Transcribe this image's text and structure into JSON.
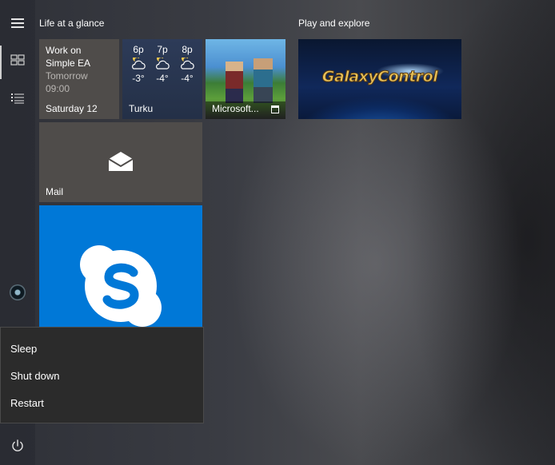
{
  "groups": {
    "life": "Life at a glance",
    "play": "Play and explore"
  },
  "calendar": {
    "event_line1": "Work on",
    "event_line2": "Simple EA",
    "when": "Tomorrow",
    "time": "09:00",
    "date": "Saturday 12"
  },
  "weather": {
    "hours": [
      {
        "time": "6p",
        "temp": "-3°"
      },
      {
        "time": "7p",
        "temp": "-4°"
      },
      {
        "time": "8p",
        "temp": "-4°"
      }
    ],
    "city": "Turku"
  },
  "roblox": {
    "label": "Microsoft..."
  },
  "galaxy": {
    "logo_text": "GalaxyControl"
  },
  "mail": {
    "label": "Mail"
  },
  "power_menu": {
    "items": [
      "Sleep",
      "Shut down",
      "Restart"
    ]
  },
  "icons": {
    "menu": "hamburger-icon",
    "tiles": "tiles-icon",
    "list": "all-apps-list-icon",
    "user": "user-avatar",
    "documents": "document-icon",
    "power": "power-icon",
    "mail": "envelope-icon",
    "skype": "skype-icon",
    "weather": "partly-cloudy-night-icon",
    "store": "store-bag-icon"
  },
  "colors": {
    "skype_tile": "#0078d7",
    "tile_gray": "#4f4c4a",
    "menu_bg": "#2b2b2b"
  }
}
